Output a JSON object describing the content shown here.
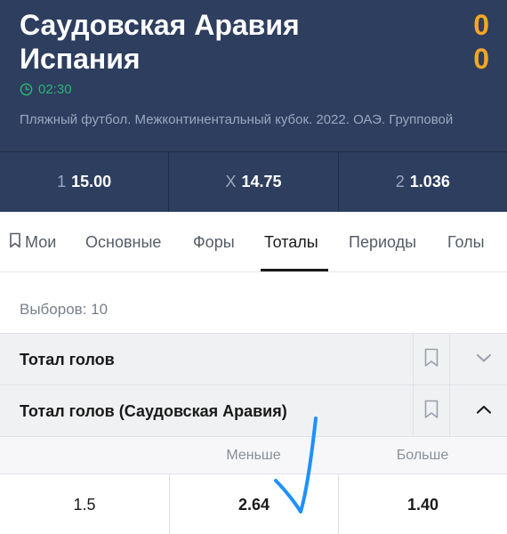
{
  "match": {
    "team1": "Саудовская Аравия",
    "team2": "Испания",
    "score1": "0",
    "score2": "0",
    "time": "02:30",
    "tournament": "Пляжный футбол. Межконтинентальный кубок. 2022. ОАЭ. Групповой"
  },
  "odds": [
    {
      "label": "1",
      "value": "15.00"
    },
    {
      "label": "X",
      "value": "14.75"
    },
    {
      "label": "2",
      "value": "1.036"
    }
  ],
  "tabs": [
    "Мои",
    "Основные",
    "Форы",
    "Тоталы",
    "Периоды",
    "Голы"
  ],
  "active_tab": "Тоталы",
  "selections_count": "Выборов: 10",
  "markets": {
    "total_goals": {
      "title": "Тотал голов"
    },
    "total_goals_team": {
      "title": "Тотал голов (Саудовская Аравия)",
      "columns": [
        "Меньше",
        "Больше"
      ],
      "rows": [
        {
          "line": "1.5",
          "under": "2.64",
          "over": "1.40"
        }
      ]
    }
  },
  "colors": {
    "header_bg": "#2d3e5f",
    "score": "#f5a623",
    "time": "#2bb673",
    "annotation": "#1e90ff"
  },
  "icons": {
    "clock": "clock-icon",
    "bookmark": "bookmark-icon",
    "chevron_down": "chevron-down-icon",
    "chevron_up": "chevron-up-icon"
  }
}
